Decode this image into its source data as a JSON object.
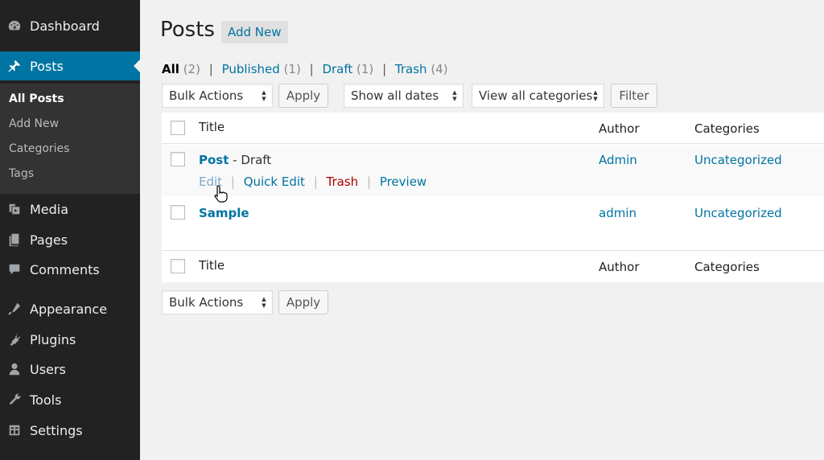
{
  "sidebar": {
    "items": [
      {
        "label": "Dashboard",
        "icon": "dashboard-icon"
      },
      {
        "label": "Posts",
        "icon": "pin-icon"
      },
      {
        "label": "Media",
        "icon": "media-icon"
      },
      {
        "label": "Pages",
        "icon": "pages-icon"
      },
      {
        "label": "Comments",
        "icon": "comments-icon"
      },
      {
        "label": "Appearance",
        "icon": "appearance-icon"
      },
      {
        "label": "Plugins",
        "icon": "plugins-icon"
      },
      {
        "label": "Users",
        "icon": "users-icon"
      },
      {
        "label": "Tools",
        "icon": "tools-icon"
      },
      {
        "label": "Settings",
        "icon": "settings-icon"
      }
    ],
    "submenu": [
      "All Posts",
      "Add New",
      "Categories",
      "Tags"
    ],
    "accent_color": "#0074a2"
  },
  "header": {
    "title": "Posts",
    "add_new": "Add New"
  },
  "filters_links": {
    "all": "All",
    "all_count": "(2)",
    "published": "Published",
    "published_count": "(1)",
    "draft": "Draft",
    "draft_count": "(1)",
    "trash": "Trash",
    "trash_count": "(4)",
    "separator": "|"
  },
  "toolbar": {
    "bulk_actions": "Bulk Actions",
    "apply": "Apply",
    "dates": "Show all dates",
    "categories": "View all categories",
    "filter": "Filter"
  },
  "table": {
    "columns": {
      "title": "Title",
      "author": "Author",
      "categories": "Categories"
    },
    "rows": [
      {
        "title": "Post",
        "state": " - Draft",
        "author": "Admin",
        "category": "Uncategorized",
        "actions": {
          "edit": "Edit",
          "quick_edit": "Quick Edit",
          "trash": "Trash",
          "preview": "Preview",
          "separator": "|"
        }
      },
      {
        "title": "Sample",
        "author": "admin",
        "category": "Uncategorized"
      }
    ]
  },
  "bottom_toolbar": {
    "bulk_actions": "Bulk Actions",
    "apply": "Apply"
  }
}
